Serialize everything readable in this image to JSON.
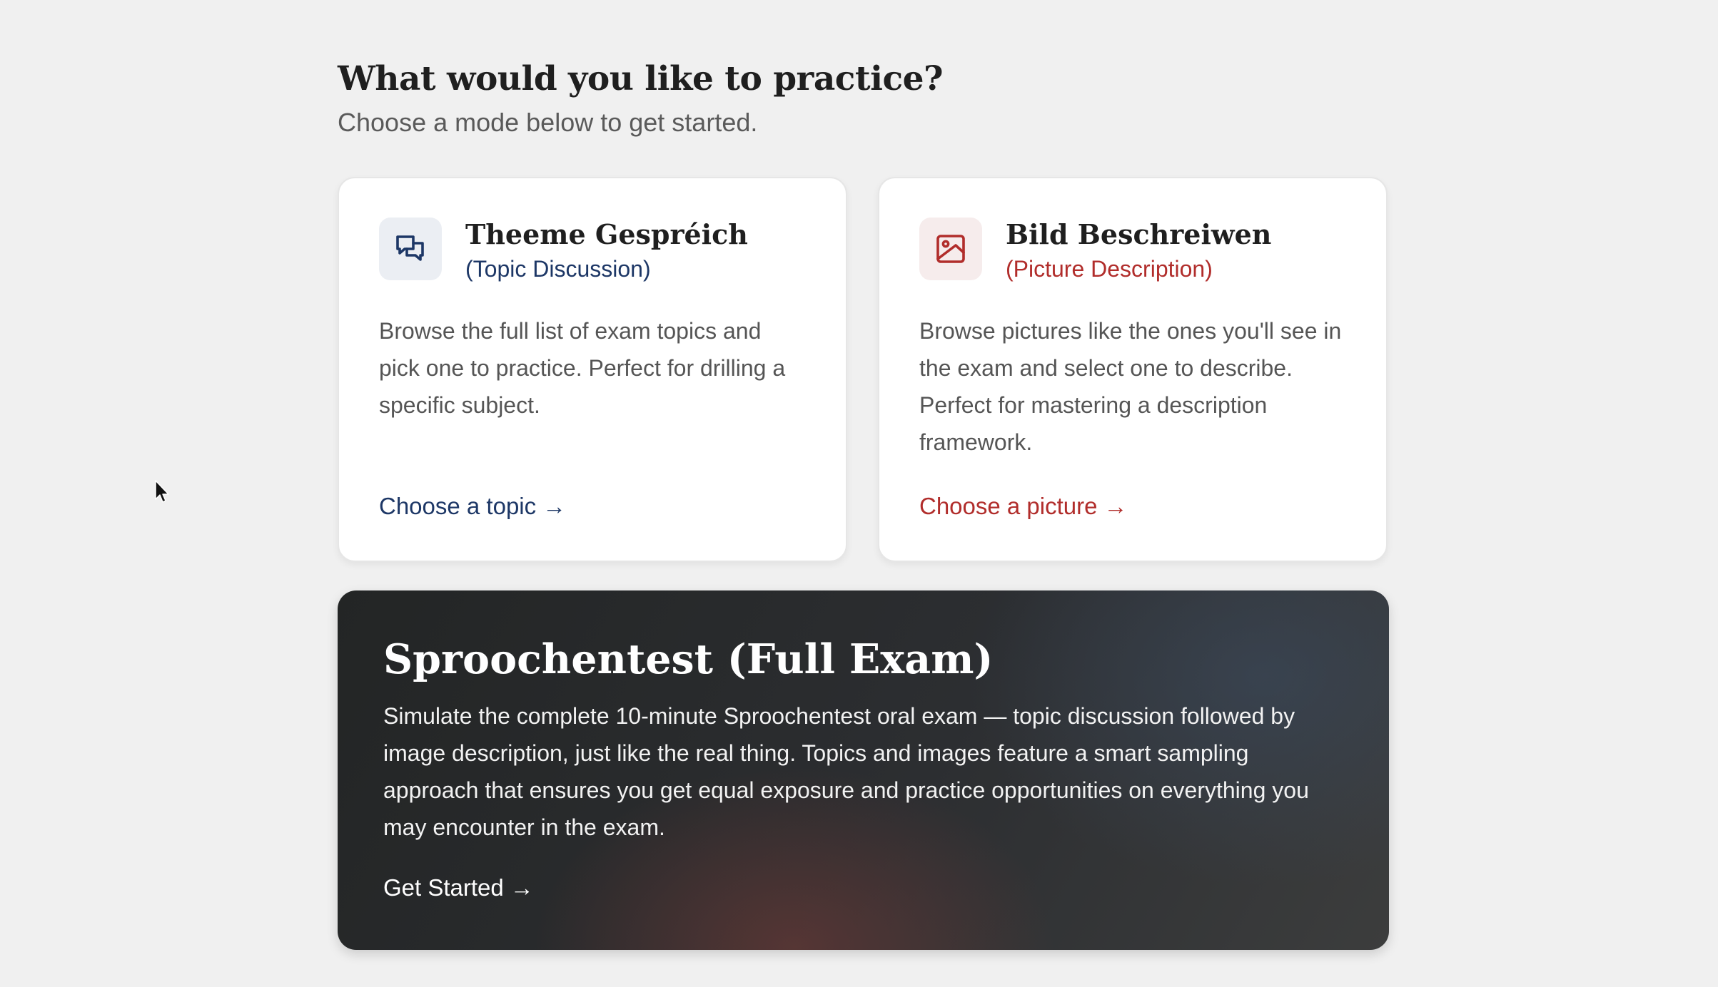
{
  "header": {
    "title": "What would you like to practice?",
    "subtitle": "Choose a mode below to get started."
  },
  "cards": [
    {
      "icon": "chat-bubbles-icon",
      "title": "Theeme Gespréich",
      "subtitle": "(Topic Discussion)",
      "description": "Browse the full list of exam topics and pick one to practice. Perfect for drilling a specific subject.",
      "link_label": "Choose a topic →",
      "accent": "#1d3766"
    },
    {
      "icon": "image-icon",
      "title": "Bild Beschreiwen",
      "subtitle": "(Picture Description)",
      "description": "Browse pictures like the ones you'll see in the exam and select one to describe. Perfect for mastering a description framework.",
      "link_label": "Choose a picture →",
      "accent": "#b12d2b"
    }
  ],
  "exam": {
    "title": "Sproochentest (Full Exam)",
    "description": "Simulate the complete 10-minute Sproochentest oral exam — topic discussion followed by image description, just like the real thing. Topics and images feature a smart sampling approach that ensures you get equal exposure and practice opportunities on everything you may encounter in the exam.",
    "link_label": "Get Started →"
  },
  "colors": {
    "background": "#f0f0f0",
    "topic_accent": "#1d3766",
    "picture_accent": "#b12d2b",
    "exam_background": "#2c2e31"
  }
}
